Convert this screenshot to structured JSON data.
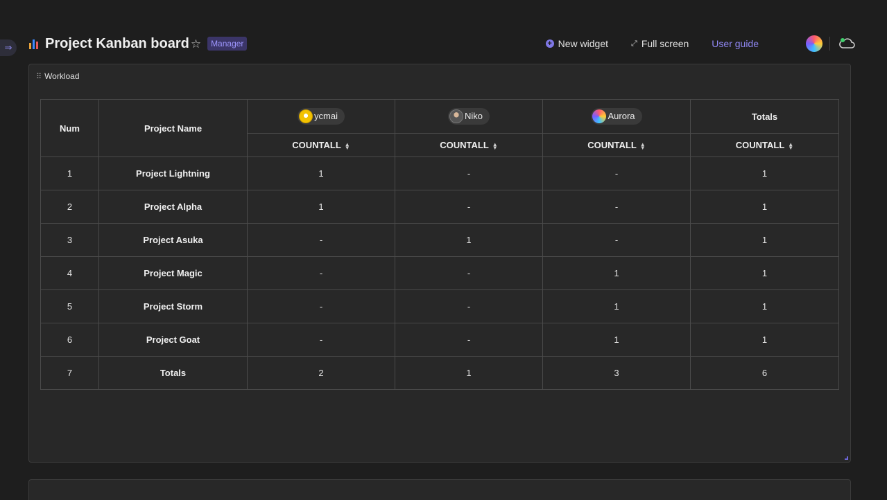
{
  "header": {
    "title": "Project Kanban board",
    "role_badge": "Manager",
    "actions": {
      "new_widget": "New widget",
      "full_screen": "Full screen",
      "user_guide": "User guide"
    }
  },
  "widget": {
    "title": "Workload",
    "columns": {
      "num": "Num",
      "project_name": "Project Name",
      "users": [
        {
          "name": "ycmai"
        },
        {
          "name": "Niko"
        },
        {
          "name": "Aurora"
        }
      ],
      "totals": "Totals",
      "metric": "COUNTALL"
    },
    "rows": [
      {
        "num": "1",
        "name": "Project Lightning",
        "ycmai": "1",
        "niko": "-",
        "aurora": "-",
        "total": "1"
      },
      {
        "num": "2",
        "name": "Project Alpha",
        "ycmai": "1",
        "niko": "-",
        "aurora": "-",
        "total": "1"
      },
      {
        "num": "3",
        "name": "Project Asuka",
        "ycmai": "-",
        "niko": "1",
        "aurora": "-",
        "total": "1"
      },
      {
        "num": "4",
        "name": "Project Magic",
        "ycmai": "-",
        "niko": "-",
        "aurora": "1",
        "total": "1"
      },
      {
        "num": "5",
        "name": "Project Storm",
        "ycmai": "-",
        "niko": "-",
        "aurora": "1",
        "total": "1"
      },
      {
        "num": "6",
        "name": "Project Goat",
        "ycmai": "-",
        "niko": "-",
        "aurora": "1",
        "total": "1"
      },
      {
        "num": "7",
        "name": "Totals",
        "ycmai": "2",
        "niko": "1",
        "aurora": "3",
        "total": "6"
      }
    ]
  },
  "colors": {
    "background": "#1e1e1e",
    "card": "#282828",
    "accent": "#8f87f2",
    "badge_bg": "#3b3568"
  }
}
